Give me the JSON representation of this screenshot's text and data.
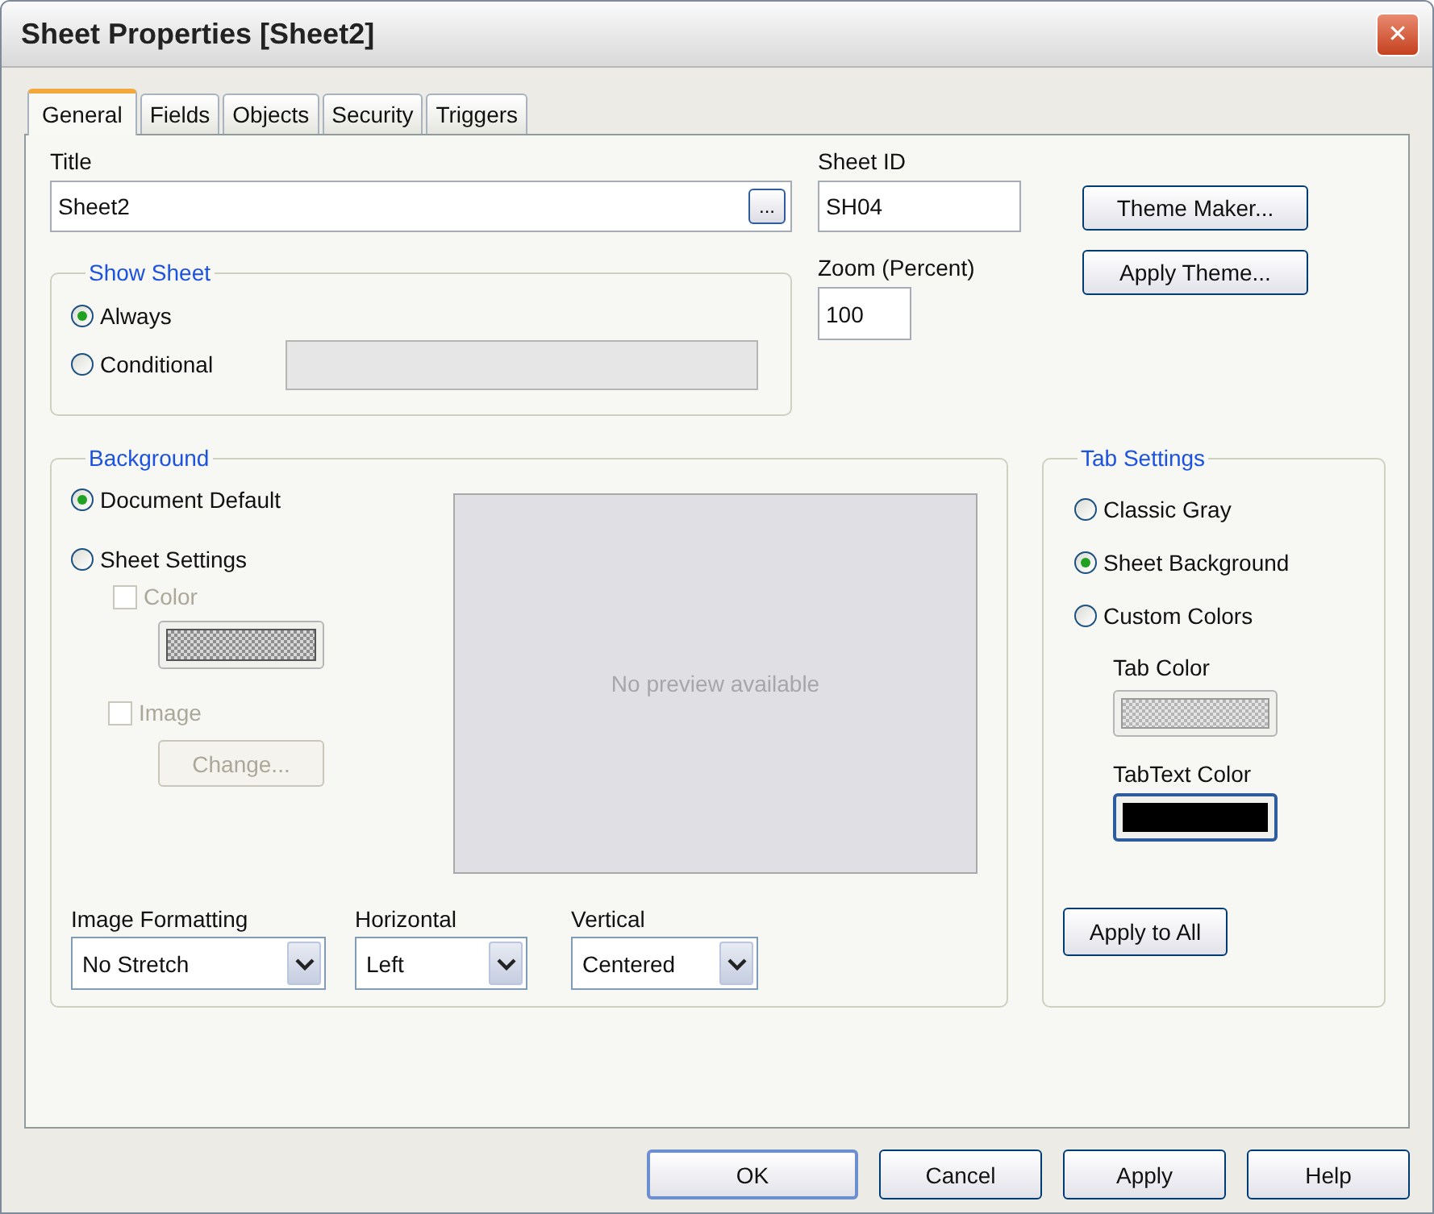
{
  "window": {
    "title": "Sheet Properties [Sheet2]",
    "close": "✕"
  },
  "tabs": [
    {
      "label": "General",
      "selected": true
    },
    {
      "label": "Fields",
      "selected": false
    },
    {
      "label": "Objects",
      "selected": false
    },
    {
      "label": "Security",
      "selected": false
    },
    {
      "label": "Triggers",
      "selected": false
    }
  ],
  "title_field": {
    "label": "Title",
    "value": "Sheet2",
    "browse_button": "..."
  },
  "sheet_id": {
    "label": "Sheet ID",
    "value": "SH04"
  },
  "zoom": {
    "label": "Zoom (Percent)",
    "value": "100"
  },
  "theme_buttons": [
    "Theme Maker...",
    "Apply Theme..."
  ],
  "show_sheet": {
    "title": "Show Sheet",
    "options": [
      {
        "label": "Always",
        "selected": true
      },
      {
        "label": "Conditional",
        "selected": false
      }
    ],
    "condition_field": {
      "disabled": true
    }
  },
  "background": {
    "title": "Background",
    "options": [
      {
        "label": "Document Default",
        "selected": true
      },
      {
        "label": "Sheet Settings",
        "selected": false
      }
    ],
    "color_checkbox": {
      "label": "Color",
      "checked": false,
      "disabled": true
    },
    "image_checkbox": {
      "label": "Image",
      "checked": false,
      "disabled": true
    },
    "change_button": {
      "label": "Change...",
      "disabled": true
    },
    "preview_text": "No preview available",
    "dropdowns": [
      {
        "label": "Image Formatting",
        "value": "No Stretch"
      },
      {
        "label": "Horizontal",
        "value": "Left"
      },
      {
        "label": "Vertical",
        "value": "Centered"
      }
    ]
  },
  "tab_settings": {
    "title": "Tab Settings",
    "options": [
      {
        "label": "Classic Gray",
        "selected": false
      },
      {
        "label": "Sheet Background",
        "selected": true
      },
      {
        "label": "Custom Colors",
        "selected": false
      }
    ],
    "tab_color": {
      "label": "Tab Color"
    },
    "tabtext_color": {
      "label": "TabText Color"
    },
    "apply_button": "Apply to All"
  },
  "footer_buttons": [
    {
      "label": "OK",
      "default": true
    },
    {
      "label": "Cancel",
      "default": false
    },
    {
      "label": "Apply",
      "default": false
    },
    {
      "label": "Help",
      "default": false
    }
  ]
}
